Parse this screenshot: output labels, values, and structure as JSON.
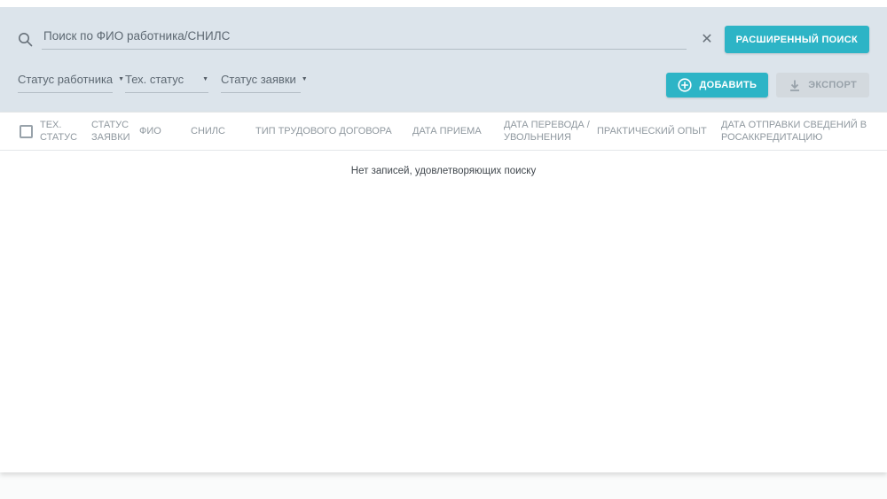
{
  "search": {
    "placeholder": "Поиск по ФИО работника/СНИЛС",
    "advanced_search_label": "РАСШИРЕННЫЙ ПОИСК"
  },
  "filters": {
    "employee_status": "Статус работника",
    "tech_status": "Тех. статус",
    "request_status": "Статус заявки"
  },
  "toolbar": {
    "add_label": "ДОБАВИТЬ",
    "export_label": "ЭКСПОРТ"
  },
  "table": {
    "columns": [
      "ТЕХ. СТАТУС",
      "СТАТУС ЗАЯВКИ",
      "ФИО",
      "СНИЛС",
      "ТИП ТРУДОВОГО ДОГОВОРА",
      "ДАТА ПРИЕМА",
      "ДАТА ПЕРЕВОДА /УВОЛЬНЕНИЯ",
      "ПРАКТИЧЕСКИЙ ОПЫТ",
      "ДАТА ОТПРАВКИ СВЕДЕНИЙ В РОСАККРЕДИТАЦИЮ"
    ],
    "empty_message": "Нет записей, удовлетворяющих поиску"
  },
  "icons": {
    "search": "magnifier",
    "clear": "✕",
    "add": "plus-circle",
    "export": "download-arrow",
    "dropdown": "▼"
  },
  "colors": {
    "accent_teal": "#2db4c6",
    "panel_background": "#dce4eb",
    "disabled_button_background": "#d3d9de",
    "header_text": "#8f989f",
    "underline": "#b3bdc5"
  }
}
